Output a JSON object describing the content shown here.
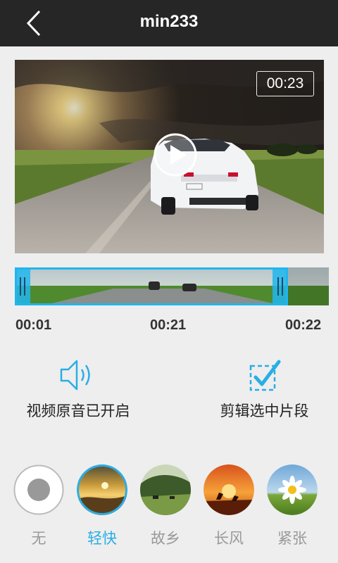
{
  "header": {
    "title": "min233",
    "back_icon": "chevron-left-icon"
  },
  "video": {
    "duration": "00:23",
    "play_icon": "play-icon"
  },
  "timeline": {
    "start": "00:01",
    "current": "00:21",
    "end": "00:22",
    "accent": "#20b6ee"
  },
  "options": {
    "sound_label": "视频原音已开启",
    "sound_icon": "speaker-icon",
    "clip_label": "剪辑选中片段",
    "clip_icon": "checkbox-checked-icon"
  },
  "filters": [
    {
      "label": "无",
      "icon": "none-filter-icon",
      "selected": false
    },
    {
      "label": "轻快",
      "icon": "sunset-icon",
      "selected": true
    },
    {
      "label": "故乡",
      "icon": "hills-icon",
      "selected": false
    },
    {
      "label": "长风",
      "icon": "kangaroo-icon",
      "selected": false
    },
    {
      "label": "紧张",
      "icon": "daisy-icon",
      "selected": false
    }
  ],
  "colors": {
    "accent": "#29aee5",
    "header_bg": "#262626",
    "background": "#eeeeee"
  }
}
